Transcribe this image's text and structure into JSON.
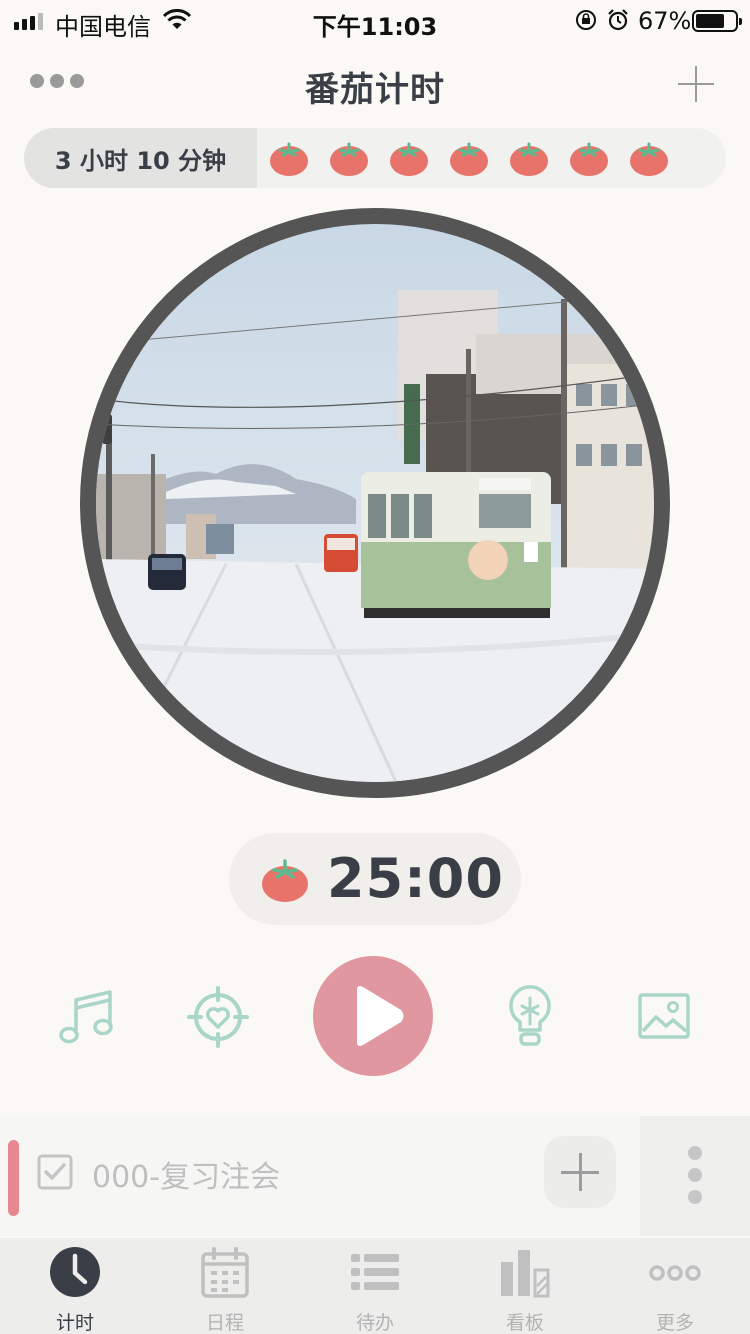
{
  "status_bar": {
    "carrier": "中国电信",
    "time": "下午11:03",
    "battery_percent": "67%",
    "battery_level": 0.67,
    "icons": [
      "signal-icon",
      "wifi-icon",
      "orientation-lock-icon",
      "alarm-icon",
      "battery-icon"
    ]
  },
  "nav": {
    "title": "番茄计时",
    "left_icon": "more-icon",
    "right_icon": "add-icon"
  },
  "summary": {
    "total_time": "3 小时 10 分钟",
    "tomato_count": 7
  },
  "timer": {
    "time": "25:00",
    "icon": "tomato-icon"
  },
  "controls": [
    "music-note-icon",
    "focus-target-icon",
    "play-icon",
    "lightbulb-icon",
    "image-icon"
  ],
  "task": {
    "label": "000-复习注会",
    "checked": true
  },
  "tabs": [
    {
      "label": "计时",
      "icon": "clock-icon",
      "active": true
    },
    {
      "label": "日程",
      "icon": "calendar-icon",
      "active": false
    },
    {
      "label": "待办",
      "icon": "list-icon",
      "active": false
    },
    {
      "label": "看板",
      "icon": "board-icon",
      "active": false
    },
    {
      "label": "更多",
      "icon": "more-dots-icon",
      "active": false
    }
  ],
  "colors": {
    "accent_red": "#e0979f",
    "tomato": "#e8736b",
    "tomato_leaf": "#5fb98f",
    "control_mint": "#a9d6c9",
    "text_dark": "#3a3f47"
  }
}
